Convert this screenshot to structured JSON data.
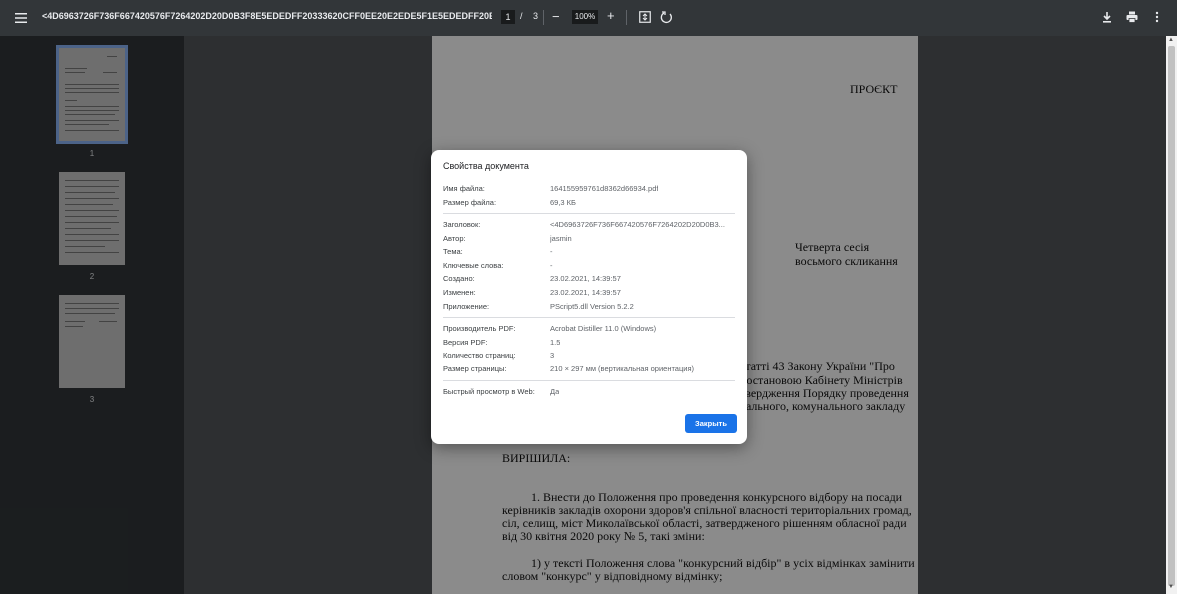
{
  "toolbar": {
    "title": "<4D6963726F736F667420576F7264202D20D0B3F8E5EDEDFF20333620CFF0EE20E2EDE5F1E5EDEDFF20E7ECB3...",
    "current_page": "1",
    "page_separator": "/",
    "total_pages": "3",
    "zoom_minus": "−",
    "zoom_level": "100%",
    "zoom_plus": "+"
  },
  "sidebar": {
    "thumbnails": [
      {
        "label": "1",
        "selected": true
      },
      {
        "label": "2",
        "selected": false
      },
      {
        "label": "3",
        "selected": false
      }
    ]
  },
  "page": {
    "header_right": "ПРОЄКТ",
    "session_line1": "Четверта сесія",
    "session_line2": "восьмого скликання",
    "para1_line1": "статті 43 Закону України \"Про",
    "para1_line2": "постановою Кабінету Міністрів",
    "para1_line3": "твердження Порядку проведення",
    "para1_line4": "рального, комунального закладу",
    "decided": "ВИРІШИЛА:",
    "item1_line1": "1. Внести до Положення про проведення конкурсного відбору на посади",
    "item1_line2": "керівників закладів охорони здоров'я спільної власності територіальних громад,",
    "item1_line3": "сіл, селищ, міст Миколаївської області, затвердженого рішенням обласної ради",
    "item1_line4": "від 30 квітня 2020 року № 5, такі зміни:",
    "item2_line1": "1) у тексті Положення слова \"конкурсний відбір\" в усіх відмінках замінити",
    "item2_line2": "словом \"конкурс\" у відповідному відмінку;"
  },
  "dialog": {
    "title": "Свойства документа",
    "groups": [
      [
        {
          "label": "Имя файла:",
          "value": "164155959761d8362d66934.pdf"
        },
        {
          "label": "Размер файла:",
          "value": "69,3 КБ"
        }
      ],
      [
        {
          "label": "Заголовок:",
          "value": "<4D6963726F736F667420576F7264202D20D0B3..."
        },
        {
          "label": "Автор:",
          "value": "jasmin"
        },
        {
          "label": "Тема:",
          "value": "-"
        },
        {
          "label": "Ключевые слова:",
          "value": "-"
        },
        {
          "label": "Создано:",
          "value": "23.02.2021, 14:39:57"
        },
        {
          "label": "Изменен:",
          "value": "23.02.2021, 14:39:57"
        },
        {
          "label": "Приложение:",
          "value": "PScript5.dll Version 5.2.2"
        }
      ],
      [
        {
          "label": "Производитель PDF:",
          "value": "Acrobat Distiller 11.0 (Windows)"
        },
        {
          "label": "Версия PDF:",
          "value": "1.5"
        },
        {
          "label": "Количество страниц:",
          "value": "3"
        },
        {
          "label": "Размер страницы:",
          "value": "210 × 297 мм (вертикальная ориентация)"
        }
      ],
      [
        {
          "label": "Быстрый просмотр в Web:",
          "value": "Да"
        }
      ]
    ],
    "close_label": "Закрыть"
  },
  "colors": {
    "toolbar_bg": "#323639",
    "viewer_bg": "#525659",
    "accent": "#1a73e8",
    "selected_thumb": "#8ab4f8"
  },
  "icons": [
    "menu-icon",
    "fit-page-icon",
    "rotate-icon",
    "download-icon",
    "print-icon",
    "more-vert-icon"
  ]
}
